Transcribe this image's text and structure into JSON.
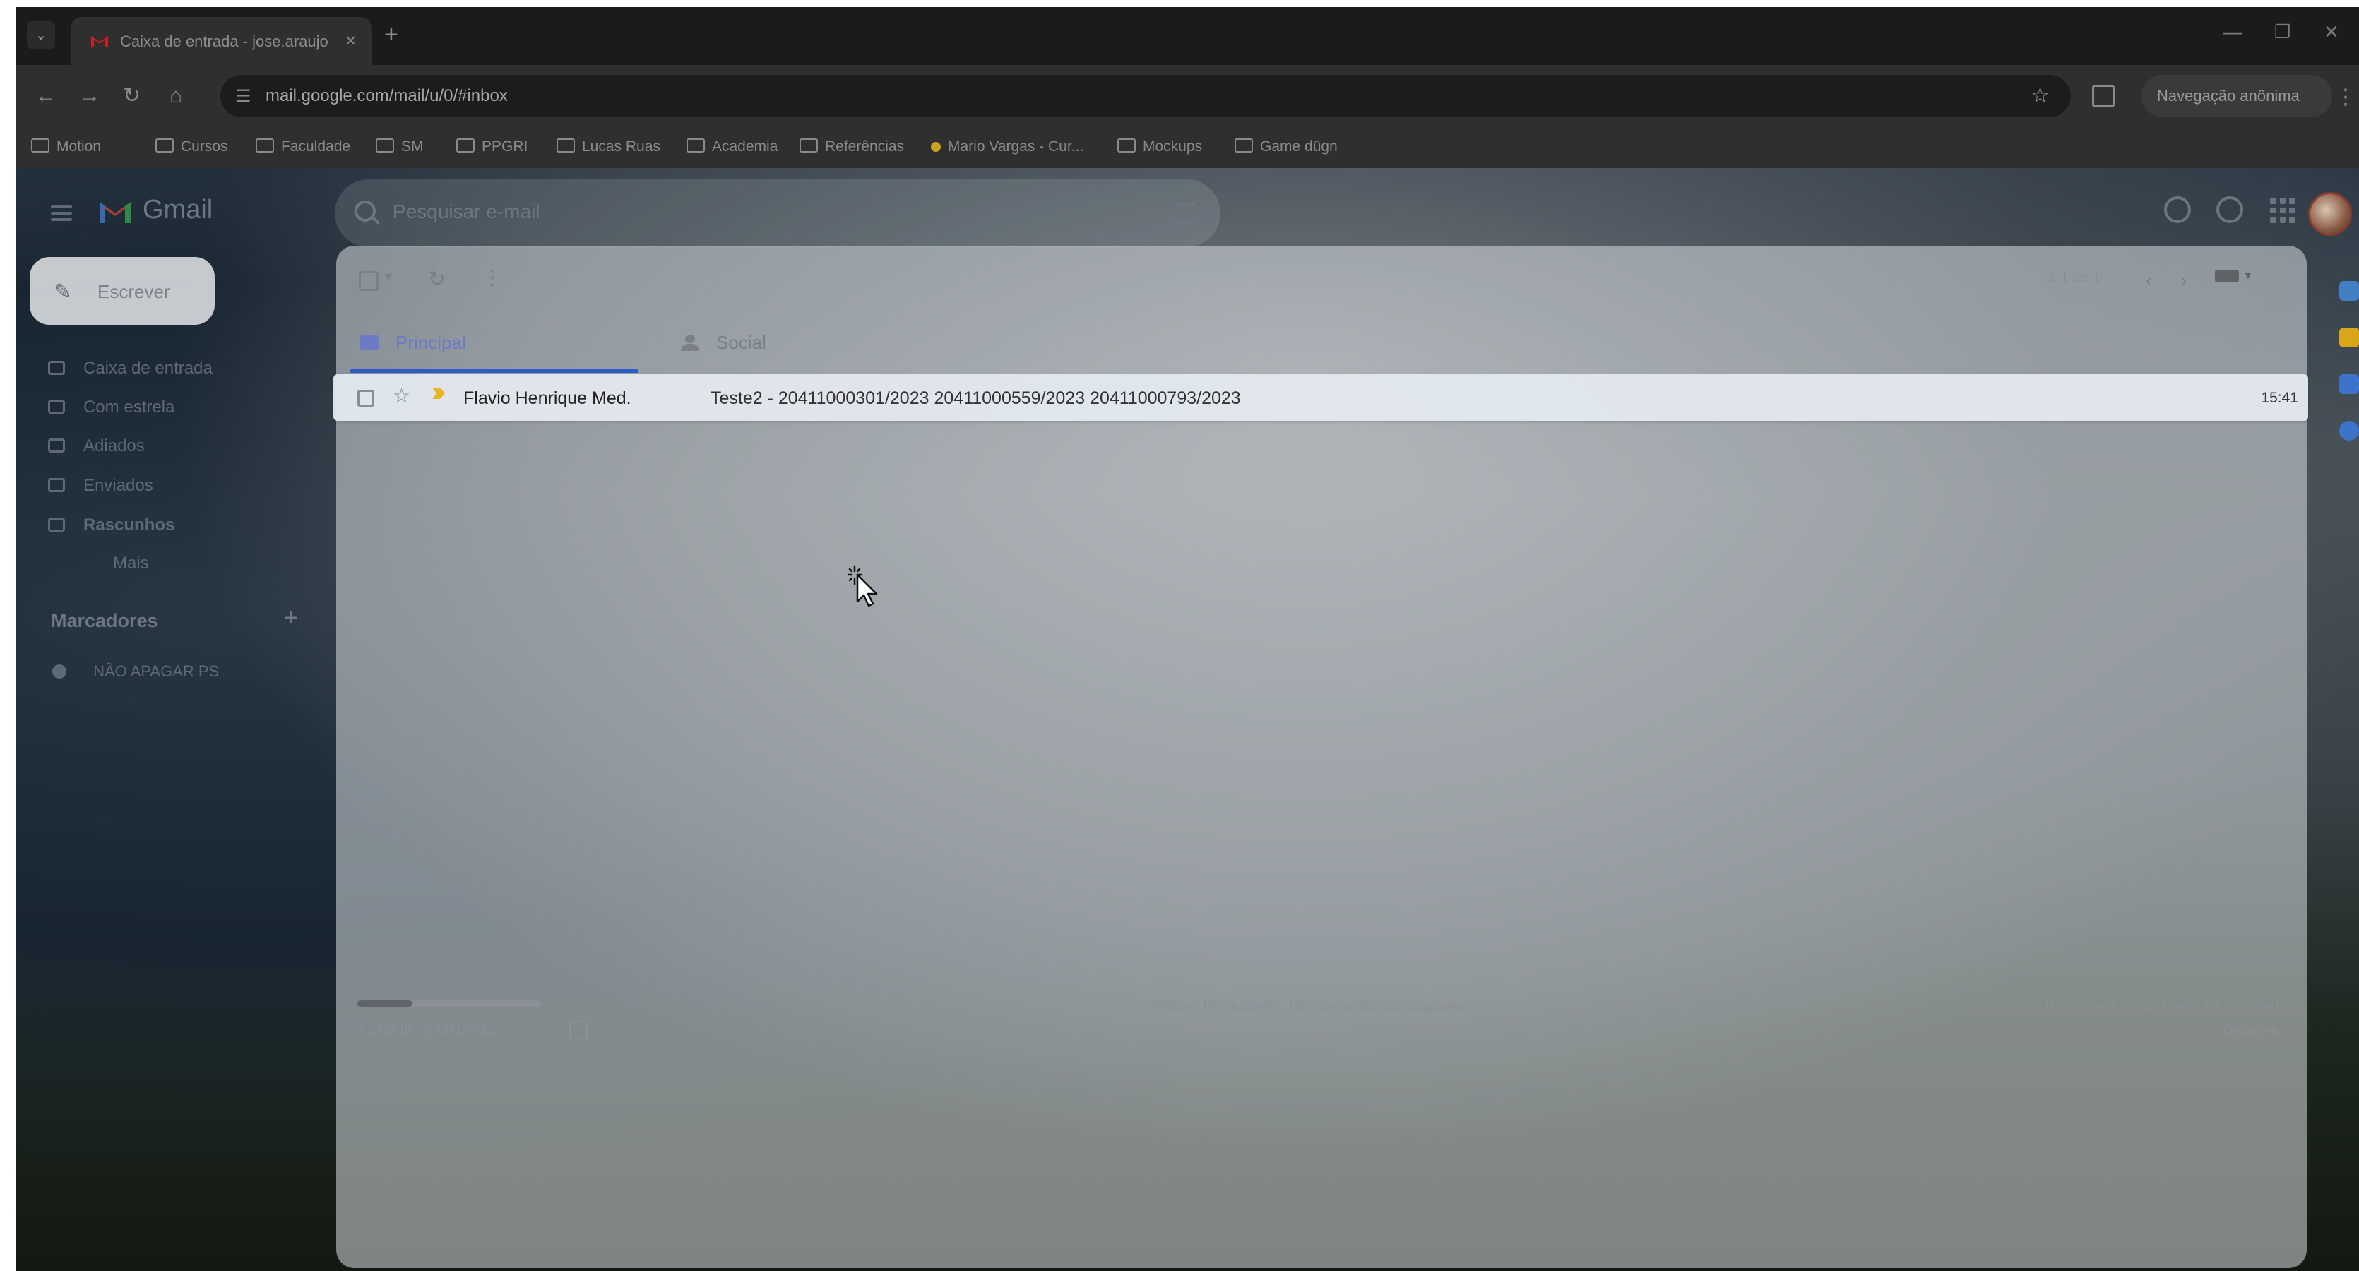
{
  "browser": {
    "tab_title": "Caixa de entrada - jose.araujo",
    "tab_close": "×",
    "new_tab": "+",
    "url": "mail.google.com/mail/u/0/#inbox",
    "incognito_label": "Navegação anônima",
    "bookmarks": [
      {
        "label": "Motion",
        "icon": "folder-icon"
      },
      {
        "label": "Cursos",
        "icon": "folder-icon"
      },
      {
        "label": "Faculdade",
        "icon": "folder-icon"
      },
      {
        "label": "SM",
        "icon": "folder-icon"
      },
      {
        "label": "PPGRI",
        "icon": "folder-icon"
      },
      {
        "label": "Lucas Ruas",
        "icon": "folder-icon"
      },
      {
        "label": "Academia",
        "icon": "folder-icon"
      },
      {
        "label": "Referências",
        "icon": "folder-icon"
      },
      {
        "label": "Mario Vargas - Cur...",
        "icon": "bookmark-dot-icon"
      },
      {
        "label": "Mockups",
        "icon": "folder-icon"
      },
      {
        "label": "Game dügn",
        "icon": "folder-icon"
      }
    ]
  },
  "gmail": {
    "app_name": "Gmail",
    "search_placeholder": "Pesquisar e-mail",
    "compose_label": "Escrever",
    "nav": [
      {
        "label": "Caixa de entrada",
        "icon": "inbox-icon"
      },
      {
        "label": "Com estrela",
        "icon": "star-icon"
      },
      {
        "label": "Adiados",
        "icon": "clock-icon"
      },
      {
        "label": "Enviados",
        "icon": "send-icon"
      },
      {
        "label": "Rascunhos",
        "icon": "draft-icon"
      },
      {
        "label": "Mais",
        "icon": "chevron-down-icon"
      }
    ],
    "labels_title": "Marcadores",
    "labels_add": "+",
    "labels": [
      {
        "label": "NÃO APAGAR PS",
        "color": "#5d6a76"
      }
    ],
    "toolbar": {
      "pagination": "1-1 de 1"
    },
    "tabs": [
      {
        "label": "Principal",
        "active": true
      },
      {
        "label": "Social",
        "active": false
      }
    ],
    "emails": [
      {
        "sender": "Flavio Henrique Med.",
        "subject": "Teste2 - 20411000301/2023 20411000559/2023 20411000793/2023",
        "time": "15:41",
        "starred": false,
        "important": true
      }
    ],
    "footer": {
      "storage_text": "4,5 GB de 15 GB usados",
      "storage_used_fraction": 0.3,
      "policy_links": "Termos · Privacidade · Regulamentos do programa",
      "last_activity": "Última atividade da conta: há 0 minuto",
      "details": "Detalhes"
    }
  },
  "colors": {
    "accent": "#2e5bc8",
    "important_marker": "#e8b420"
  }
}
